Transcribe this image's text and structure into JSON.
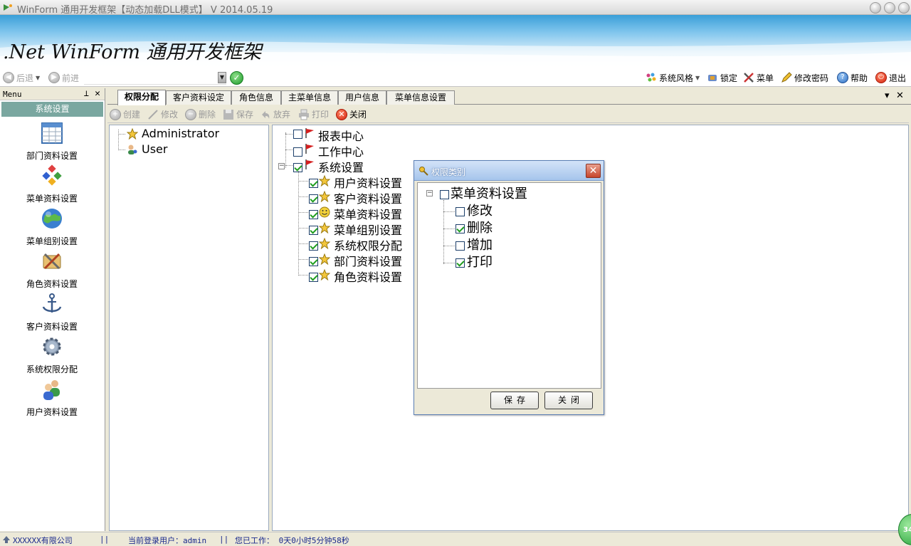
{
  "window": {
    "title": "WinForm 通用开发框架【动态加载DLL模式】 V 2014.05.19"
  },
  "banner": {
    "logo_text": ".Net WinForm 通用开发框架"
  },
  "nav": {
    "back": "后退",
    "forward": "前进",
    "url": "",
    "theme": "系统风格",
    "lock": "锁定",
    "menu": "菜单",
    "change_password": "修改密码",
    "help": "帮助",
    "exit": "退出"
  },
  "menu_panel": {
    "header": "Menu",
    "pin_glyph": "⊥",
    "close_glyph": "✕",
    "group": "系统设置",
    "items": [
      {
        "label": "部门资料设置",
        "icon": "table-icon"
      },
      {
        "label": "菜单资料设置",
        "icon": "blocks-icon"
      },
      {
        "label": "菜单组别设置",
        "icon": "globe-icon"
      },
      {
        "label": "角色资料设置",
        "icon": "tools-icon"
      },
      {
        "label": "客户资料设置",
        "icon": "anchor-icon"
      },
      {
        "label": "系统权限分配",
        "icon": "gear-icon"
      },
      {
        "label": "用户资料设置",
        "icon": "users-icon"
      }
    ]
  },
  "tabs": [
    {
      "label": "权限分配",
      "active": true
    },
    {
      "label": "客户资料设定",
      "active": false
    },
    {
      "label": "角色信息",
      "active": false
    },
    {
      "label": "主菜单信息",
      "active": false
    },
    {
      "label": "用户信息",
      "active": false
    },
    {
      "label": "菜单信息设置",
      "active": false
    }
  ],
  "tab_controls": {
    "dropdown": "▾",
    "close": "✕"
  },
  "actions": {
    "create": "创建",
    "edit": "修改",
    "delete": "删除",
    "save": "保存",
    "discard": "放弃",
    "print": "打印",
    "close": "关闭"
  },
  "roles": [
    {
      "label": "Administrator",
      "icon": "star-icon"
    },
    {
      "label": "User",
      "icon": "user-icon"
    }
  ],
  "rights_tree": {
    "roots": [
      {
        "label": "报表中心",
        "checked": false
      },
      {
        "label": "工作中心",
        "checked": false
      },
      {
        "label": "系统设置",
        "checked": true
      }
    ],
    "children": [
      {
        "label": "用户资料设置",
        "checked": true,
        "icon": "star-icon"
      },
      {
        "label": "客户资料设置",
        "checked": true,
        "icon": "star-icon"
      },
      {
        "label": "菜单资料设置",
        "checked": true,
        "icon": "smiley-icon"
      },
      {
        "label": "菜单组别设置",
        "checked": true,
        "icon": "star-icon"
      },
      {
        "label": "系统权限分配",
        "checked": true,
        "icon": "star-icon"
      },
      {
        "label": "部门资料设置",
        "checked": true,
        "icon": "star-icon"
      },
      {
        "label": "角色资料设置",
        "checked": true,
        "icon": "star-icon"
      }
    ]
  },
  "dialog": {
    "title": "权限类别",
    "close_glyph": "✕",
    "root": {
      "label": "菜单资料设置",
      "checked": false
    },
    "permissions": [
      {
        "label": "修改",
        "checked": false
      },
      {
        "label": "删除",
        "checked": true
      },
      {
        "label": "增加",
        "checked": false
      },
      {
        "label": "打印",
        "checked": true
      }
    ],
    "save": "保存",
    "close": "关闭"
  },
  "status": {
    "company": "XXXXXX有限公司",
    "sep1": "||",
    "user": "当前登录用户：admin",
    "sep2": "||",
    "worked": "您已工作： 0天0小时5分钟58秒",
    "badge": "34"
  },
  "colors": {
    "group_header": "#7aa7a0",
    "status_text": "#1a2a8c",
    "check_mark": "#1f9d1f"
  }
}
